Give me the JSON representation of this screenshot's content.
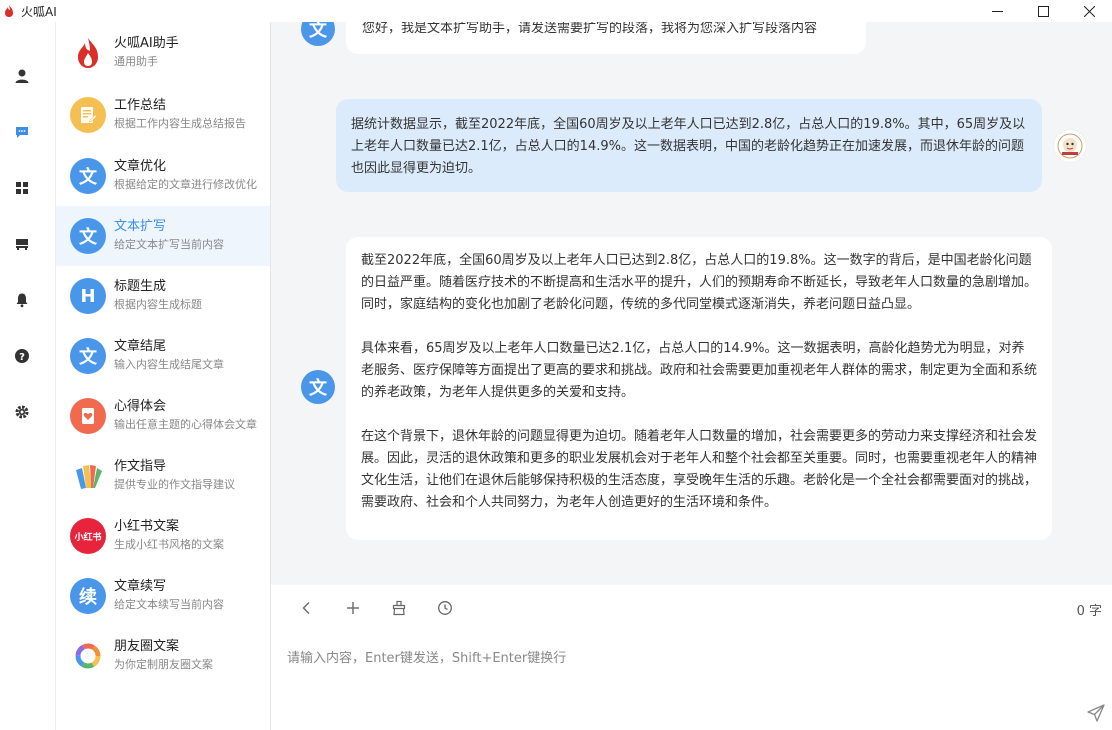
{
  "window": {
    "title": "火呱AI",
    "controls": [
      "minimize",
      "maximize",
      "close"
    ]
  },
  "rail": {
    "icons": [
      "user-icon",
      "chat-icon",
      "apps-icon",
      "store-icon",
      "bell-icon",
      "help-icon",
      "settings-icon"
    ]
  },
  "assistants": [
    {
      "name": "火呱AI助手",
      "desc": "通用助手"
    },
    {
      "name": "工作总结",
      "desc": "根据工作内容生成总结报告"
    },
    {
      "name": "文章优化",
      "desc": "根据给定的文章进行修改优化"
    },
    {
      "name": "文本扩写",
      "desc": "给定文本扩写当前内容"
    },
    {
      "name": "标题生成",
      "desc": "根据内容生成标题"
    },
    {
      "name": "文章结尾",
      "desc": "输入内容生成结尾文章"
    },
    {
      "name": "心得体会",
      "desc": "输出任意主题的心得体会文章"
    },
    {
      "name": "作文指导",
      "desc": "提供专业的作文指导建议"
    },
    {
      "name": "小红书文案",
      "desc": "生成小红书风格的文案"
    },
    {
      "name": "文章续写",
      "desc": "给定文本续写当前内容"
    },
    {
      "name": "朋友圈文案",
      "desc": "为你定制朋友圈文案"
    }
  ],
  "avatars": {
    "wen": "文",
    "h": "H",
    "xu": "续",
    "xiaohongshu": "小红书"
  },
  "chat": {
    "greeting": "您好，我是文本扩写助手，请发送需要扩写的段落，我将为您深入扩写段落内容",
    "user_message": "据统计数据显示，截至2022年底，全国60周岁及以上老年人口已达到2.8亿，占总人口的19.8%。其中，65周岁及以上老年人口数量已达2.1亿，占总人口的14.9%。这一数据表明，中国的老龄化趋势正在加速发展，而退休年龄的问题也因此显得更为迫切。",
    "bot_reply": [
      "截至2022年底，全国60周岁及以上老年人口已达到2.8亿，占总人口的19.8%。这一数字的背后，是中国老龄化问题的日益严重。随着医疗技术的不断提高和生活水平的提升，人们的预期寿命不断延长，导致老年人口数量的急剧增加。同时，家庭结构的变化也加剧了老龄化问题，传统的多代同堂模式逐渐消失，养老问题日益凸显。",
      "具体来看，65周岁及以上老年人口数量已达2.1亿，占总人口的14.9%。这一数据表明，高龄化趋势尤为明显，对养老服务、医疗保障等方面提出了更高的要求和挑战。政府和社会需要更加重视老年人群体的需求，制定更为全面和系统的养老政策，为老年人提供更多的关爱和支持。",
      "在这个背景下，退休年龄的问题显得更为迫切。随着老年人口数量的增加，社会需要更多的劳动力来支撑经济和社会发展。因此，灵活的退休政策和更多的职业发展机会对于老年人和整个社会都至关重要。同时，也需要重视老年人的精神文化生活，让他们在退休后能够保持积极的生活态度，享受晚年生活的乐趣。老龄化是一个全社会都需要面对的挑战，需要政府、社会和个人共同努力，为老年人创造更好的生活环境和条件。"
    ]
  },
  "input": {
    "toolbar": [
      "back-icon",
      "add-icon",
      "broom-icon",
      "history-icon"
    ],
    "char_count": "0 字",
    "placeholder": "请输入内容，Enter键发送，Shift+Enter键换行"
  },
  "colors": {
    "accent": "#3d8ee8",
    "avatar_blue": "#4a97ea",
    "user_bubble": "#dcebfb",
    "chat_bg": "#f3f5f7",
    "active_item": "#eef5fd"
  }
}
